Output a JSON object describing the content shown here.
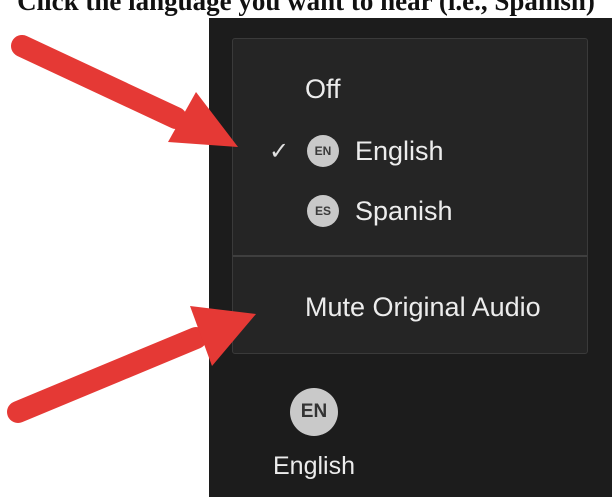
{
  "caption": "Click the language you want to hear (i.e., Spanish)",
  "menu": {
    "items": [
      {
        "label": "Off",
        "checked": false,
        "badge": ""
      },
      {
        "label": "English",
        "checked": true,
        "badge": "EN"
      },
      {
        "label": "Spanish",
        "checked": false,
        "badge": "ES"
      }
    ],
    "mute_label": "Mute Original Audio",
    "check_glyph": "✓"
  },
  "toolbar": {
    "interpretation_badge": "EN",
    "interpretation_label": "English"
  },
  "colors": {
    "panel_bg": "#1c1c1c",
    "menu_bg": "#252525",
    "arrow": "#e53935",
    "badge_bg": "#c9c9c9"
  }
}
